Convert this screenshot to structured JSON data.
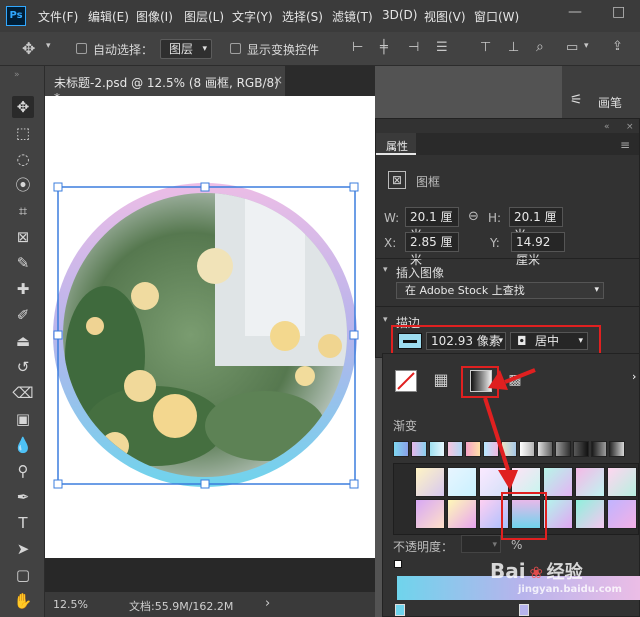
{
  "app": {
    "logo": "Ps"
  },
  "menu": [
    "文件(F)",
    "编辑(E)",
    "图像(I)",
    "图层(L)",
    "文字(Y)",
    "选择(S)",
    "滤镜(T)",
    "3D(D)",
    "视图(V)",
    "窗口(W)"
  ],
  "window_controls": {
    "minimize": "—",
    "maximize": "□"
  },
  "options": {
    "auto_select_label": "自动选择：",
    "auto_select_value": "图层",
    "show_transform_label": "显示变换控件"
  },
  "doc_tab": {
    "title": "未标题-2.psd @ 12.5% (8 画框, RGB/8) *",
    "close": "×"
  },
  "status": {
    "zoom": "12.5%",
    "doc_info": "文档:55.9M/162.2M",
    "arrow": "›"
  },
  "right_panel": {
    "label": "画笔"
  },
  "properties": {
    "tab": "属性",
    "type_label": "图框",
    "w_label": "W:",
    "w_value": "20.1 厘米",
    "h_label": "H:",
    "h_value": "20.1 厘米",
    "x_label": "X:",
    "x_value": "2.85 厘米",
    "y_label": "Y:",
    "y_value": "14.92 厘米",
    "insert_image_header": "插入图像",
    "stock_button": "在 Adobe Stock 上查找",
    "stroke_header": "描边",
    "stroke_width": "102.93 像素",
    "stroke_align": "居中"
  },
  "gradient_panel": {
    "header": "渐变",
    "opacity_label": "不透明度：",
    "opacity_unit": "%"
  },
  "watermark": {
    "brand": "Bai",
    "brand2": "经验",
    "url": "jingyan.baidu.com"
  },
  "colors": {
    "accent_red": "#e02020",
    "selection_blue": "#3b7ddd",
    "ring_pink": "#e6b8e6",
    "ring_cyan": "#6fd4ec"
  }
}
